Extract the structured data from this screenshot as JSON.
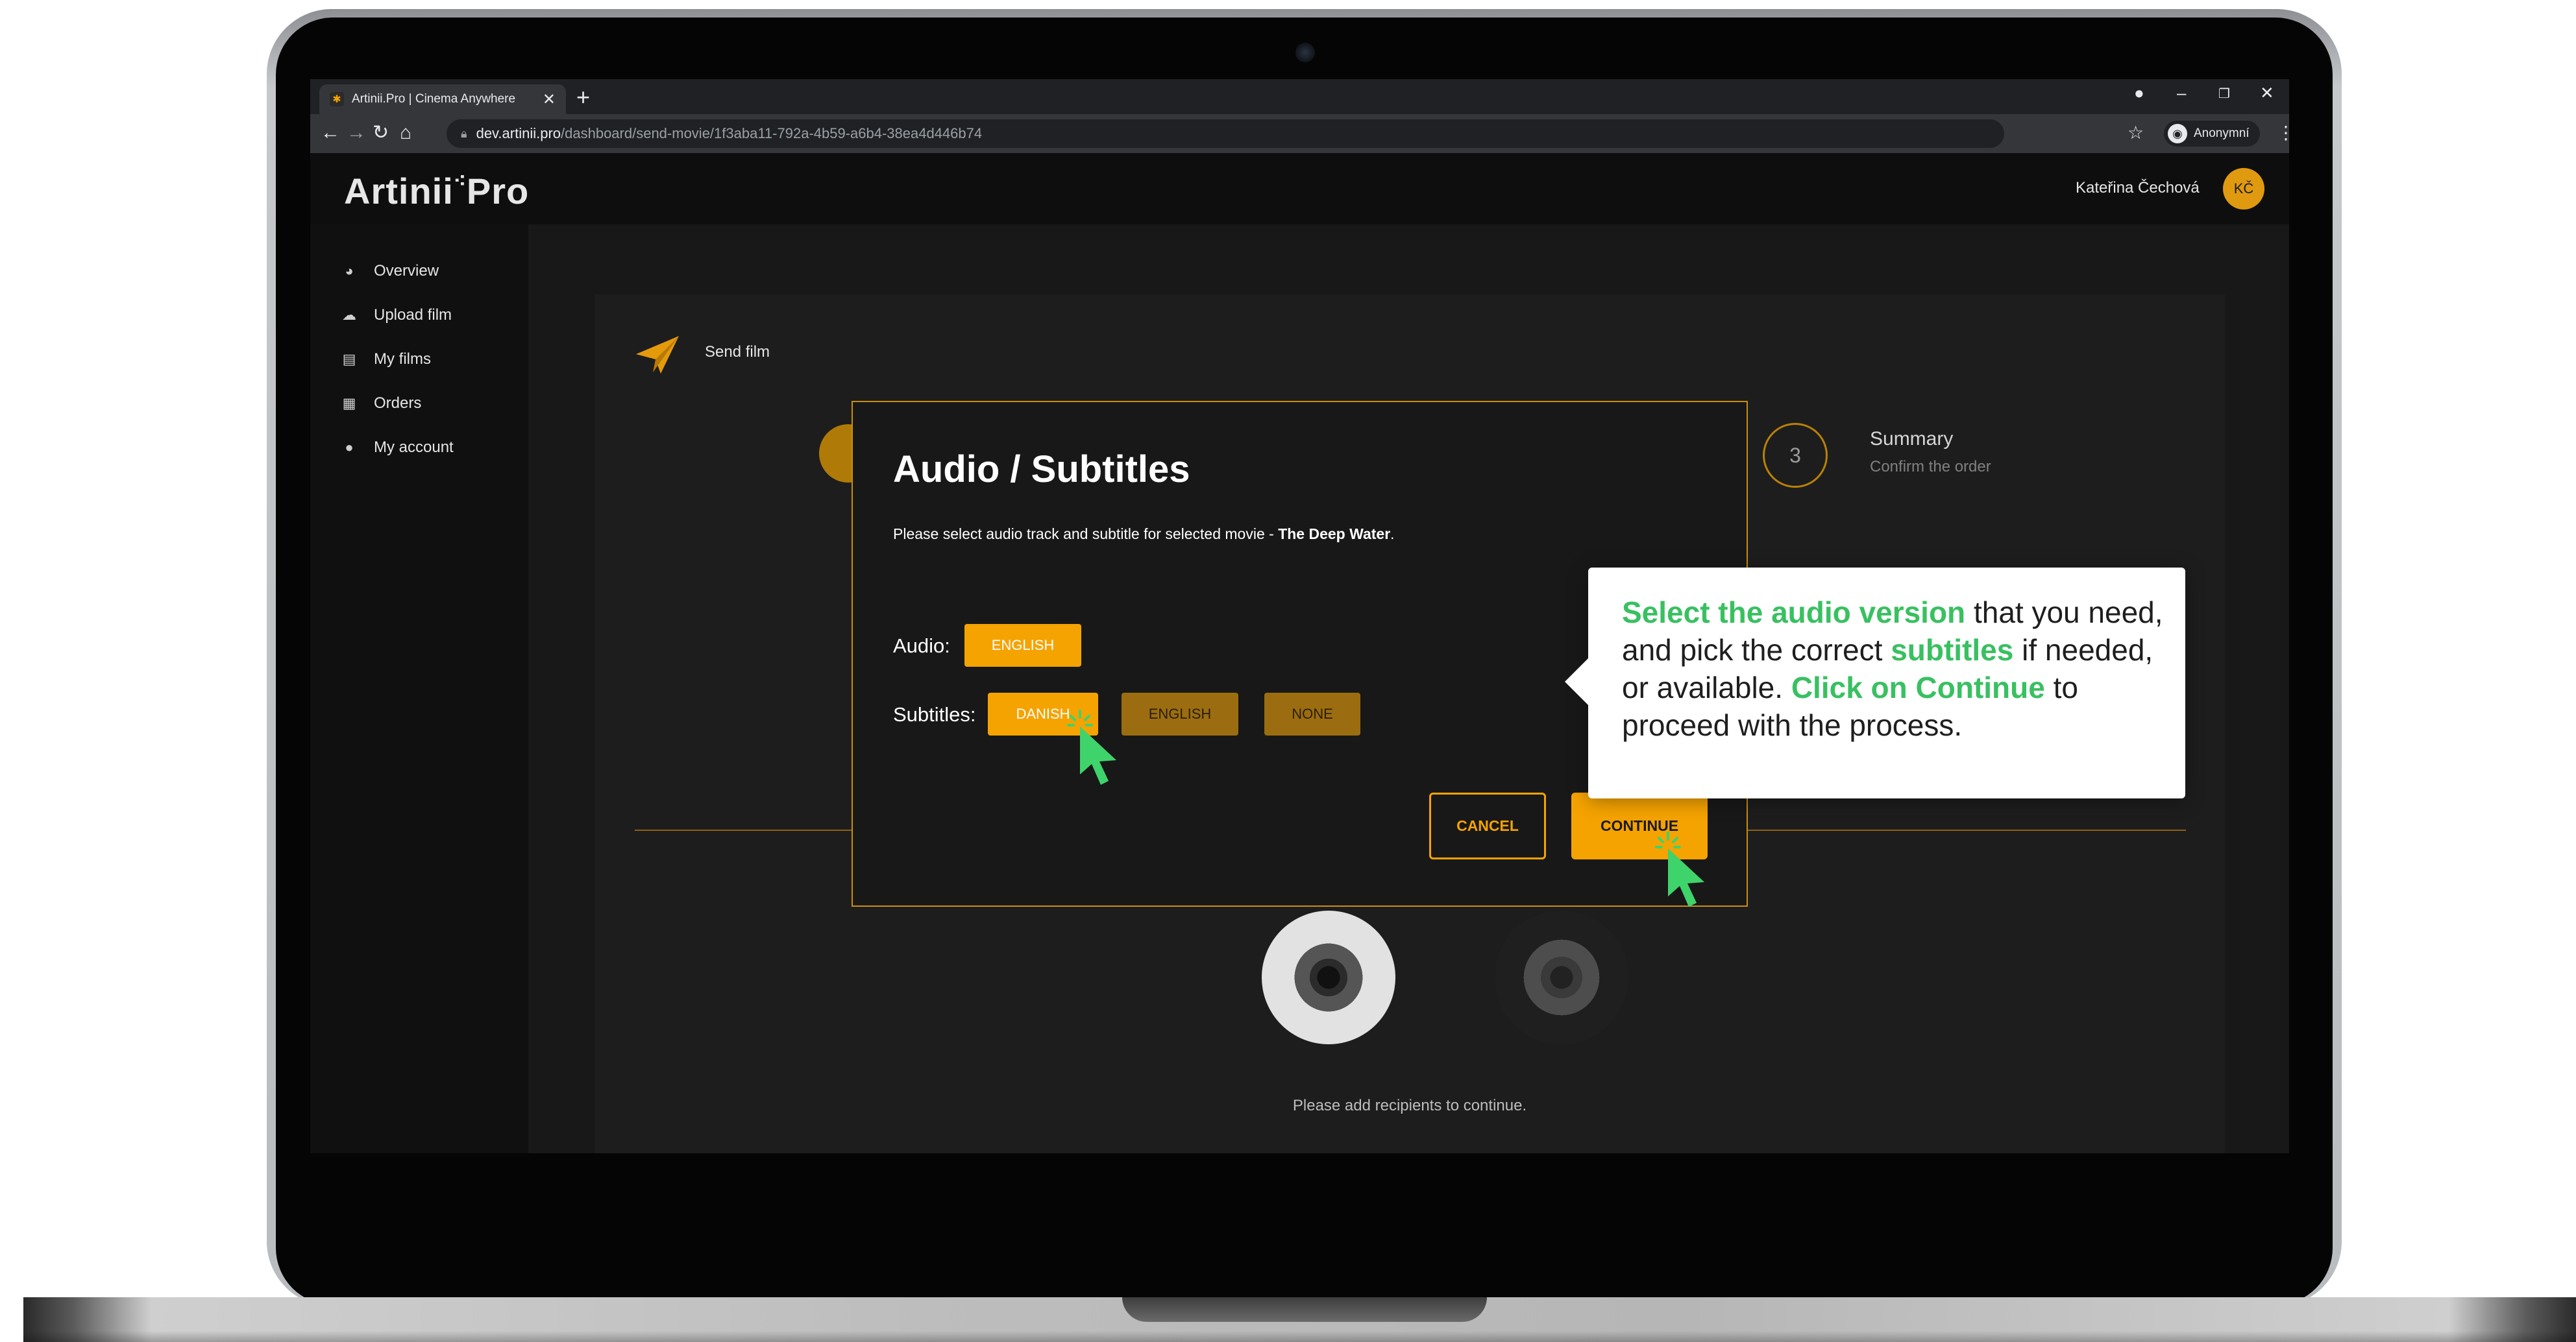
{
  "browser": {
    "tab_title": "Artinii.Pro | Cinema Anywhere",
    "tab_close": "✕",
    "new_tab": "+",
    "url_host": "dev.artinii.pro",
    "url_path": "/dashboard/send-movie/1f3aba11-792a-4b59-a6b4-38ea4d446b74",
    "profile_label": "Anonymní"
  },
  "app": {
    "logo_text": "Artinii",
    "logo_suffix": "Pro",
    "user_name": "Kateřina Čechová",
    "user_initials": "KČ",
    "accent": "#f5a300"
  },
  "sidebar": {
    "items": [
      {
        "label": "Overview",
        "icon": "dashboard-icon"
      },
      {
        "label": "Upload film",
        "icon": "cloud-upload-icon"
      },
      {
        "label": "My films",
        "icon": "film-icon"
      },
      {
        "label": "Orders",
        "icon": "document-icon"
      },
      {
        "label": "My account",
        "icon": "user-icon"
      }
    ]
  },
  "page": {
    "title": "Send film",
    "step3_number": "3",
    "step3_title": "Summary",
    "step3_subtitle": "Confirm the order",
    "recipients_hint": "Please add recipients to continue."
  },
  "modal": {
    "title": "Audio / Subtitles",
    "description_prefix": "Please select audio track and subtitle for selected movie - ",
    "movie_title": "The Deep Water",
    "description_suffix": ".",
    "audio_label": "Audio:",
    "audio_options": [
      {
        "label": "ENGLISH",
        "selected": true
      }
    ],
    "subtitles_label": "Subtitles:",
    "subtitle_options": [
      {
        "label": "DANISH",
        "selected": true
      },
      {
        "label": "ENGLISH",
        "selected": false
      },
      {
        "label": "NONE",
        "selected": false
      }
    ],
    "cancel_label": "CANCEL",
    "continue_label": "CONTINUE"
  },
  "callout": {
    "part1": "Select the audio version",
    "part2": " that you need, and pick the correct ",
    "part3": "subtitles",
    "part4": " if needed, or available. ",
    "part5": "Click on Continue",
    "part6": " to proceed with the process.",
    "highlight_color": "#39c061"
  }
}
